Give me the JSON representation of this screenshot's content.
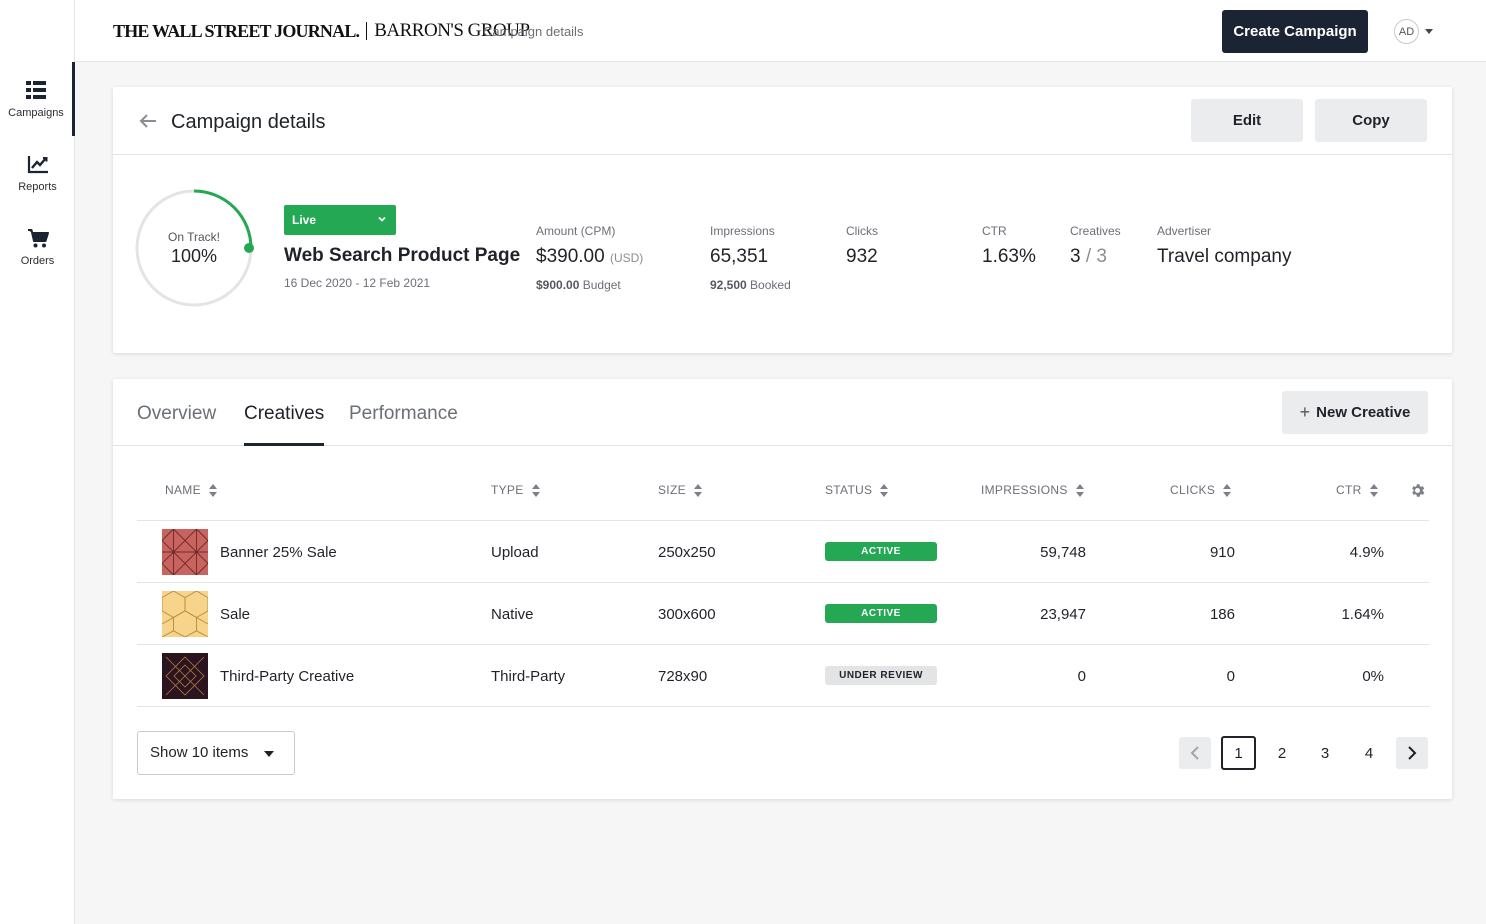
{
  "sidebar": {
    "items": [
      {
        "label": "Campaigns",
        "icon": "list-icon"
      },
      {
        "label": "Reports",
        "icon": "chart-icon"
      },
      {
        "label": "Orders",
        "icon": "cart-icon"
      }
    ]
  },
  "header": {
    "logo_left": "THE WALL STREET JOURNAL.",
    "logo_right": "BARRON'S GROUP",
    "breadcrumb": "Campaign details",
    "create_label": "Create Campaign",
    "avatar": "AD"
  },
  "campaign": {
    "title": "Campaign details",
    "edit_label": "Edit",
    "copy_label": "Copy",
    "ring_label": "On Track!",
    "ring_value": "100%",
    "status": "Live",
    "name": "Web Search Product Page",
    "dates": "16 Dec 2020 - 12 Feb 2021",
    "stats": {
      "amount": {
        "label": "Amount (CPM)",
        "value": "$390.00",
        "unit": "(USD)",
        "sub_value": "$900.00",
        "sub_label": "Budget"
      },
      "impressions": {
        "label": "Impressions",
        "value": "65,351",
        "sub_value": "92,500",
        "sub_label": "Booked"
      },
      "clicks": {
        "label": "Clicks",
        "value": "932"
      },
      "ctr": {
        "label": "CTR",
        "value": "1.63%"
      },
      "creatives": {
        "label": "Creatives",
        "value": "3",
        "total": "/ 3"
      },
      "advertiser": {
        "label": "Advertiser",
        "value": "Travel company"
      }
    }
  },
  "creatives": {
    "tabs": [
      "Overview",
      "Creatives",
      "Performance"
    ],
    "new_label": "New Creative",
    "columns": [
      "NAME",
      "TYPE",
      "SIZE",
      "STATUS",
      "IMPRESSIONS",
      "CLICKS",
      "CTR"
    ],
    "rows": [
      {
        "name": "Banner 25% Sale",
        "type": "Upload",
        "size": "250x250",
        "status": "ACTIVE",
        "impressions": "59,748",
        "clicks": "910",
        "ctr": "4.9%"
      },
      {
        "name": "Sale",
        "type": "Native",
        "size": "300x600",
        "status": "ACTIVE",
        "impressions": "23,947",
        "clicks": "186",
        "ctr": "1.64%"
      },
      {
        "name": "Third-Party Creative",
        "type": "Third-Party",
        "size": "728x90",
        "status": "UNDER REVIEW",
        "impressions": "0",
        "clicks": "0",
        "ctr": "0%"
      }
    ],
    "show_label": "Show 10 items",
    "pages": [
      "1",
      "2",
      "3",
      "4"
    ]
  },
  "colors": {
    "primary": "#1b2432",
    "success": "#24a853",
    "thumb1": "#c9635f",
    "thumb2": "#f7d48c",
    "thumb3": "#2a1420"
  }
}
